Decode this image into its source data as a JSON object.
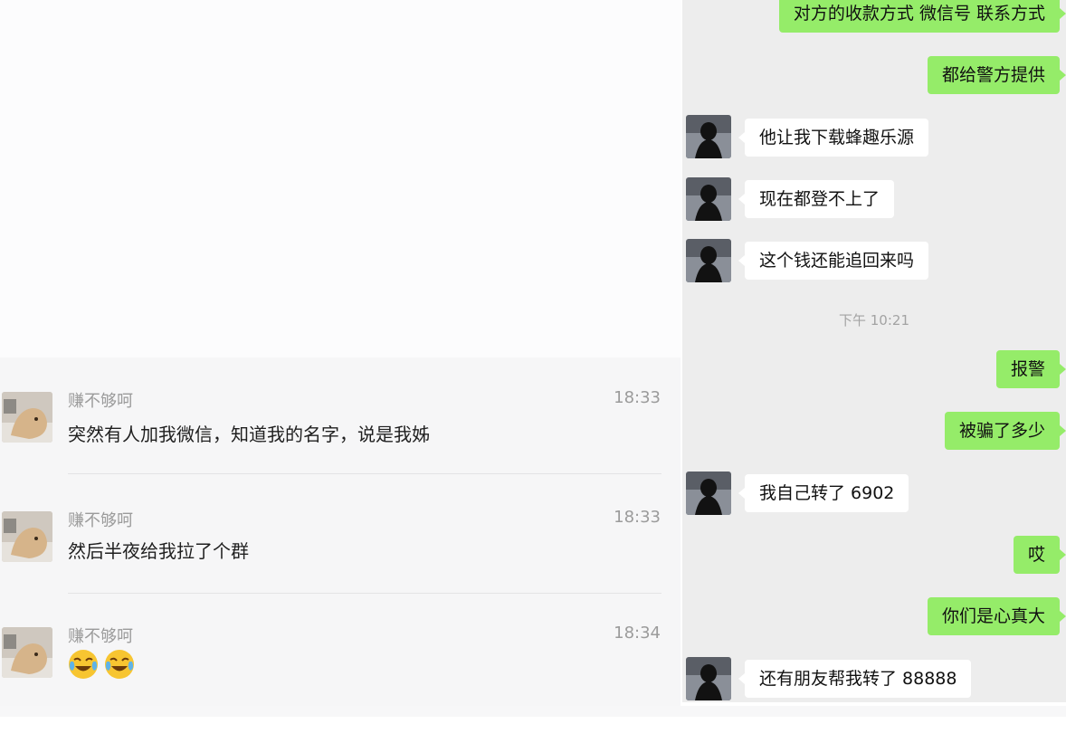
{
  "left_list": {
    "items": [
      {
        "name": "赚不够呵",
        "time": "18:33",
        "message": "突然有人加我微信，知道我的名字，说是我姊"
      },
      {
        "name": "赚不够呵",
        "time": "18:33",
        "message": "然后半夜给我拉了个群"
      },
      {
        "name": "赚不够呵",
        "time": "18:34",
        "message": "",
        "emojis": [
          "cry-laugh-emoji",
          "cry-laugh-emoji"
        ]
      }
    ]
  },
  "chat": {
    "messages": [
      {
        "side": "me",
        "text": "对方的收款方式 微信号 联系方式"
      },
      {
        "side": "me",
        "text": "都给警方提供"
      },
      {
        "side": "them",
        "text": "他让我下载蜂趣乐源"
      },
      {
        "side": "them",
        "text": "现在都登不上了"
      },
      {
        "side": "them",
        "text": "这个钱还能追回来吗"
      },
      {
        "side": "me",
        "text": "报警"
      },
      {
        "side": "me",
        "text": "被骗了多少"
      },
      {
        "side": "them",
        "text": "我自己转了 6902"
      },
      {
        "side": "me",
        "text": "哎"
      },
      {
        "side": "me",
        "text": "你们是心真大"
      },
      {
        "side": "them",
        "text": "还有朋友帮我转了 88888"
      }
    ],
    "timestamp": "下午 10:21"
  },
  "colors": {
    "me_bubble": "#95ec69",
    "them_bubble": "#ffffff",
    "chat_bg": "#ededed"
  }
}
